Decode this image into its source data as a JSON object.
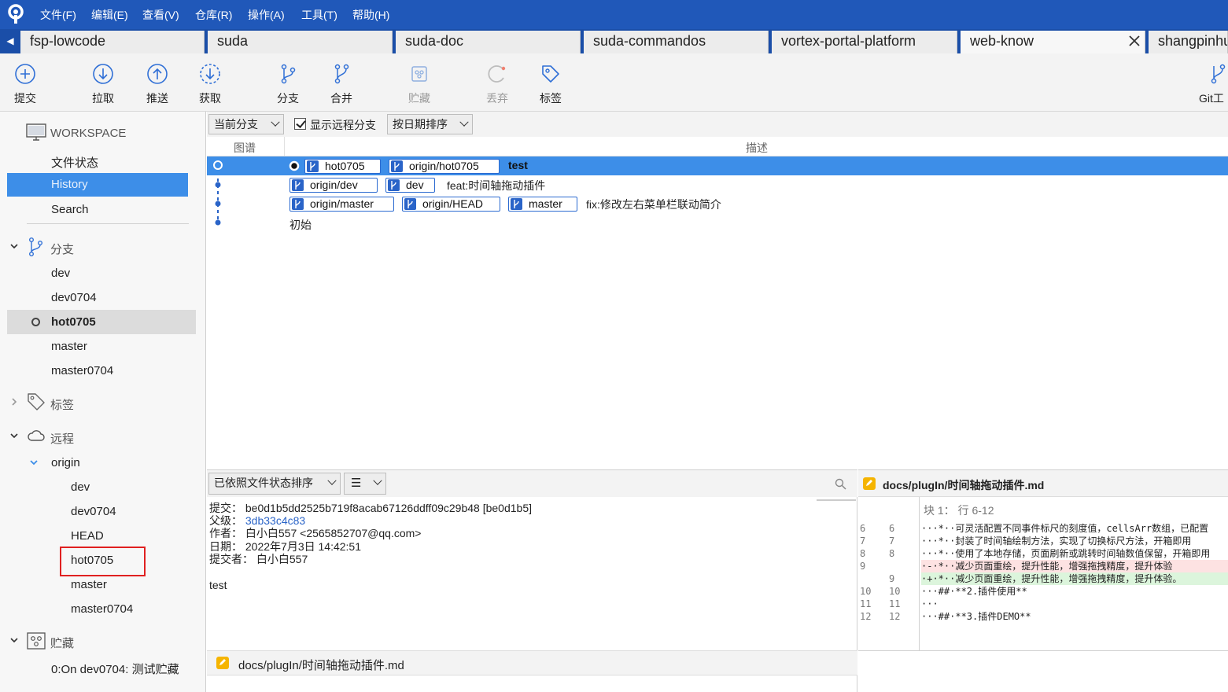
{
  "menubar": {
    "items": [
      "文件(F)",
      "编辑(E)",
      "查看(V)",
      "仓库(R)",
      "操作(A)",
      "工具(T)",
      "帮助(H)"
    ]
  },
  "tabs": {
    "items": [
      "fsp-lowcode",
      "suda",
      "suda-doc",
      "suda-commandos",
      "vortex-portal-platform",
      "web-know",
      "shangpinhu"
    ],
    "active": "web-know"
  },
  "toolbar": {
    "commit": "提交",
    "pull": "拉取",
    "push": "推送",
    "fetch": "获取",
    "branch": "分支",
    "merge": "合并",
    "stash": "贮藏",
    "discard": "丢弃",
    "tag": "标签",
    "git_flow": "Git工"
  },
  "sidebar": {
    "workspace": "WORKSPACE",
    "file_status": "文件状态",
    "history": "History",
    "search": "Search",
    "branches_title": "分支",
    "branches": [
      "dev",
      "dev0704",
      "hot0705",
      "master",
      "master0704"
    ],
    "current_branch": "hot0705",
    "tags_title": "标签",
    "remotes_title": "远程",
    "remote_name": "origin",
    "remote_branches": [
      "dev",
      "dev0704",
      "HEAD",
      "hot0705",
      "master",
      "master0704"
    ],
    "stash_title": "贮藏",
    "stash_item": "0:On dev0704: 测试贮藏"
  },
  "filter": {
    "branch_scope": "当前分支",
    "show_remote": "显示远程分支",
    "show_remote_checked": true,
    "sort": "按日期排序"
  },
  "columns": {
    "graph": "图谱",
    "description": "描述"
  },
  "commits": [
    {
      "refs": [
        "hot0705",
        "origin/hot0705"
      ],
      "message": "test",
      "selected": true,
      "head": true
    },
    {
      "refs": [
        "origin/dev",
        "dev"
      ],
      "message": "feat:时间轴拖动插件",
      "selected": false
    },
    {
      "refs": [
        "origin/master",
        "origin/HEAD",
        "master"
      ],
      "message": "fix:修改左右菜单栏联动简介",
      "selected": false
    },
    {
      "refs": [],
      "message": "初始",
      "selected": false
    }
  ],
  "details": {
    "sort_mode": "已依照文件状态排序",
    "view_mode_icon": "list-icon",
    "commit_label": "提交：",
    "commit_value": "be0d1b5dd2525b719f8acab67126ddff09c29b48 [be0d1b5]",
    "parent_label": "父级：",
    "parent_value": "3db33c4c83",
    "author_label": "作者：",
    "author_value": "白小白557 <2565852707@qq.com>",
    "date_label": "日期：",
    "date_value": "2022年7月3日 14:42:51",
    "committer_label": "提交者：",
    "committer_value": "白小白557",
    "message": "test",
    "file": "docs/plugIn/时间轴拖动插件.md"
  },
  "diff": {
    "file": "docs/plugIn/时间轴拖动插件.md",
    "hunk": "块 1： 行 6-12",
    "lines": [
      {
        "old": "6",
        "new": "6",
        "type": "ctx",
        "text": "···*··可灵活配置不同事件标尺的刻度值，cellsArr数组，已配置"
      },
      {
        "old": "7",
        "new": "7",
        "type": "ctx",
        "text": "···*··封装了时间轴绘制方法，实现了切换标尺方法，开箱即用"
      },
      {
        "old": "8",
        "new": "8",
        "type": "ctx",
        "text": "···*··使用了本地存储，页面刷新或跳转时间轴数值保留，开箱即用"
      },
      {
        "old": "9",
        "new": "",
        "type": "del",
        "text": "·-·*··减少页面重绘，提升性能，增强拖拽精度，提升体验"
      },
      {
        "old": "",
        "new": "9",
        "type": "add",
        "text": "·+·*··减少页面重绘，提升性能，增强拖拽精度，提升体验。"
      },
      {
        "old": "10",
        "new": "10",
        "type": "ctx",
        "text": "···##·**2.插件使用**"
      },
      {
        "old": "11",
        "new": "11",
        "type": "ctx",
        "text": "···"
      },
      {
        "old": "12",
        "new": "12",
        "type": "ctx",
        "text": "···##·**3.插件DEMO**"
      }
    ]
  },
  "colors": {
    "menubar": "#2058b9",
    "selection": "#3d8ee8",
    "ref_badge": "#2a64c8",
    "highlight_box": "#e02020"
  }
}
